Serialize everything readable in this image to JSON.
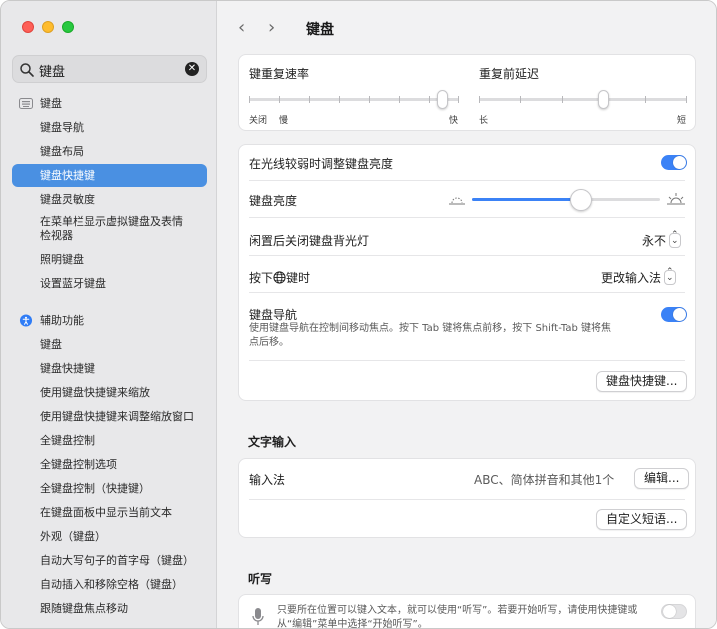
{
  "search": {
    "value": "键盘"
  },
  "sidebar": {
    "items": [
      {
        "label": "键盘"
      },
      {
        "label": "键盘导航"
      },
      {
        "label": "键盘布局"
      },
      {
        "label": "键盘快捷键"
      },
      {
        "label": "键盘灵敏度"
      },
      {
        "label": "在菜单栏显示虚拟键盘及表情检视器"
      },
      {
        "label": "照明键盘"
      },
      {
        "label": "设置蓝牙键盘"
      },
      {
        "label": "辅助功能"
      },
      {
        "label": "键盘"
      },
      {
        "label": "键盘快捷键"
      },
      {
        "label": "使用键盘快捷键来缩放"
      },
      {
        "label": "使用键盘快捷键来调整缩放窗口"
      },
      {
        "label": "全键盘控制"
      },
      {
        "label": "全键盘控制选项"
      },
      {
        "label": "全键盘控制（快捷键）"
      },
      {
        "label": "在键盘面板中显示当前文本"
      },
      {
        "label": "外观（键盘）"
      },
      {
        "label": "自动大写句子的首字母（键盘）"
      },
      {
        "label": "自动插入和移除空格（键盘）"
      },
      {
        "label": "跟随键盘焦点移动"
      }
    ]
  },
  "header": {
    "back": "‹",
    "forward": "›",
    "title": "键盘"
  },
  "repeat": {
    "rate_label": "键重复速率",
    "rate_ticks": [
      "关闭",
      "慢",
      "快"
    ],
    "rate_value": 0.92,
    "delay_label": "重复前延迟",
    "delay_ticks": [
      "长",
      "短"
    ],
    "delay_value": 0.6
  },
  "backlight": {
    "adjust_label": "在光线较弱时调整键盘亮度",
    "adjust_on": true,
    "brightness_label": "键盘亮度",
    "brightness_value": 0.58,
    "off_label": "闲置后关闭键盘背光灯",
    "off_value": "永不"
  },
  "globe": {
    "label_pre": "按下",
    "label_post": "键时",
    "value": "更改输入法"
  },
  "navigation": {
    "label": "键盘导航",
    "desc": "使用键盘导航在控制间移动焦点。按下 Tab 键将焦点前移，按下 Shift-Tab 键将焦点后移。",
    "on": true,
    "shortcuts_button": "键盘快捷键..."
  },
  "text_input": {
    "section": "文字输入",
    "label": "输入法",
    "value": "ABC、简体拼音和其他1个",
    "edit_button": "编辑...",
    "replace_button": "自定义短语..."
  },
  "dictation": {
    "section": "听写",
    "desc": "只要所在位置可以键入文本，就可以使用“听写”。若要开始听写，请使用快捷键或从“编辑”菜单中选择“开始听写”。",
    "on": false
  },
  "colors": {
    "accent": "#3b82f6",
    "selection": "#4a90e2"
  }
}
